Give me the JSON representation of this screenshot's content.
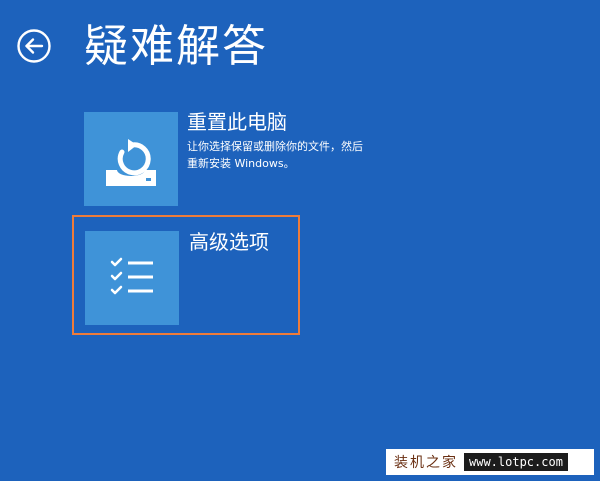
{
  "page": {
    "title": "疑难解答"
  },
  "options": {
    "reset": {
      "icon": "reset-pc-icon",
      "title": "重置此电脑",
      "description_line1": "让你选择保留或删除你的文件，然后",
      "description_line2": "重新安装 Windows。"
    },
    "advanced": {
      "icon": "checklist-icon",
      "title": "高级选项"
    }
  },
  "watermark": {
    "name": "装机之家",
    "url": "www.lotpc.com"
  },
  "colors": {
    "background": "#1d62bc",
    "tile": "#3f93d8",
    "highlight_border": "#ee7c3a",
    "text": "#ffffff"
  },
  "icons": {
    "back": "back-arrow-icon"
  }
}
